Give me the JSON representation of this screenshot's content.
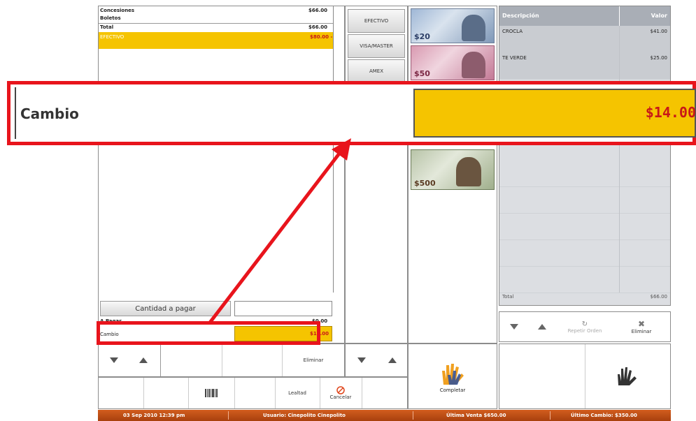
{
  "summary": {
    "concesiones_label": "Concesiones",
    "concesiones_value": "$66.00",
    "boletos_label": "Boletos",
    "total_label": "Total",
    "total_value": "$66.00",
    "payment_method": "EFECTIVO",
    "payment_value": "$80.00 -"
  },
  "payment_methods": [
    "EFECTIVO",
    "VISA/MASTER",
    "AMEX"
  ],
  "bills": [
    "$20",
    "$50",
    "$500"
  ],
  "order": {
    "col_description": "Descripción",
    "col_value": "Valor",
    "items": [
      {
        "name": "CROCLA",
        "value": "$41.00"
      },
      {
        "name": "TE VERDE",
        "value": "$25.00"
      }
    ],
    "total_label": "Total",
    "total_value": "$66.00"
  },
  "payment": {
    "cantidad_label": "Cantidad a pagar",
    "apagar_label": "A Pagar",
    "apagar_value": "$0.00",
    "cambio_label": "Cambio",
    "cambio_value": "$14.00"
  },
  "callout": {
    "label": "Cambio",
    "value": "$14.00"
  },
  "toolbar": {
    "eliminar": "Eliminar",
    "lealtad": "Lealtad",
    "cancelar": "Cancelar",
    "completar": "Completar",
    "repetir_orden": "Repetir Orden",
    "eliminar_order": "Eliminar"
  },
  "status": {
    "datetime": "03 Sep 2010 12:39 pm",
    "usuario": "Usuario:  Cinepolito  Cinepolito",
    "ultima_venta": "Última Venta  $650.00",
    "ultimo_cambio": "Último Cambio:  $350.00"
  },
  "colors": {
    "highlight_yellow": "#f5c400",
    "callout_red": "#e8141c",
    "value_red": "#c81818",
    "status_orange": "#c44f15",
    "order_header": "#a9aeb6"
  }
}
